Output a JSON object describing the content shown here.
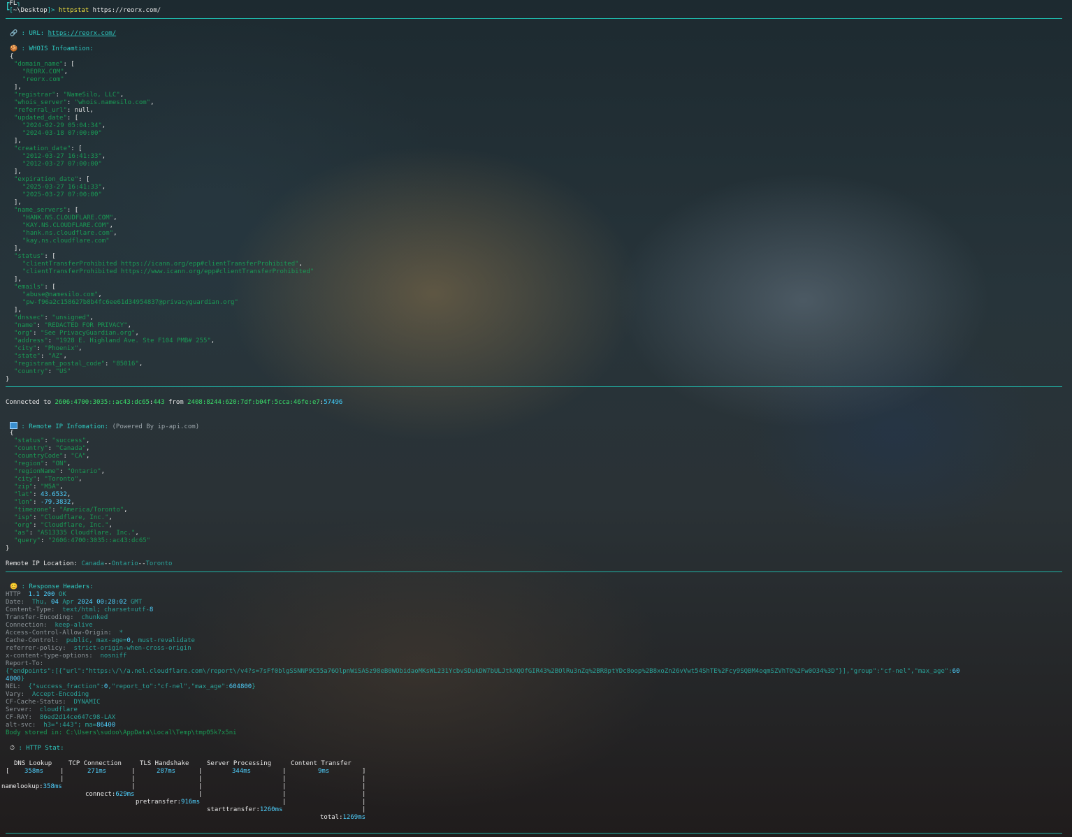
{
  "prompt": {
    "tag": "FL",
    "path": "~\\Desktop",
    "command": "httpstat",
    "arg": "https://reorx.com/"
  },
  "url_section": {
    "label": "URL:",
    "url": "https://reorx.com/"
  },
  "whois": {
    "title": "WHOIS Infoamtion:",
    "domain_name": [
      "REORX.COM",
      "reorx.com"
    ],
    "registrar": "NameSilo, LLC",
    "whois_server": "whois.namesilo.com",
    "referral_url": "null",
    "updated_date": [
      "2024-02-29 05:04:34",
      "2024-03-18 07:00:00"
    ],
    "creation_date": [
      "2012-03-27 16:41:33",
      "2012-03-27 07:00:00"
    ],
    "expiration_date": [
      "2025-03-27 16:41:33",
      "2025-03-27 07:00:00"
    ],
    "name_servers": [
      "HANK.NS.CLOUDFLARE.COM",
      "KAY.NS.CLOUDFLARE.COM",
      "hank.ns.cloudflare.com",
      "kay.ns.cloudflare.com"
    ],
    "status": [
      "clientTransferProhibited https://icann.org/epp#clientTransferProhibited",
      "clientTransferProhibited https://www.icann.org/epp#clientTransferProhibited"
    ],
    "emails": [
      "abuse@namesilo.com",
      "pw-f96a2c158627b8b4fc6ee61d34954837@privacyguardian.org"
    ],
    "dnssec": "unsigned",
    "name": "REDACTED FOR PRIVACY",
    "org": "See PrivacyGuardian.org",
    "address": "1928 E. Highland Ave. Ste F104 PMB# 255",
    "city": "Phoenix",
    "state": "AZ",
    "registrant_postal_code": "85016",
    "country": "US"
  },
  "connection": {
    "prefix": "Connected to",
    "remote_addr": "2606:4700:3035::ac43:dc65",
    "remote_port": "443",
    "from_word": "from",
    "local_addr": "2408:8244:620:7df:b04f:5cca:46fe:e7",
    "local_port": "57496"
  },
  "remote_ip": {
    "title": "Remote IP Infomation:",
    "powered": "(Powered By ip-api.com)",
    "fields": [
      {
        "k": "status",
        "v": "success",
        "t": "s"
      },
      {
        "k": "country",
        "v": "Canada",
        "t": "s"
      },
      {
        "k": "countryCode",
        "v": "CA",
        "t": "s"
      },
      {
        "k": "region",
        "v": "ON",
        "t": "s"
      },
      {
        "k": "regionName",
        "v": "Ontario",
        "t": "s"
      },
      {
        "k": "city",
        "v": "Toronto",
        "t": "s"
      },
      {
        "k": "zip",
        "v": "M5A",
        "t": "s"
      },
      {
        "k": "lat",
        "v": "43.6532",
        "t": "n"
      },
      {
        "k": "lon",
        "v": "-79.3832",
        "t": "n"
      },
      {
        "k": "timezone",
        "v": "America/Toronto",
        "t": "s"
      },
      {
        "k": "isp",
        "v": "Cloudflare, Inc.",
        "t": "s"
      },
      {
        "k": "org",
        "v": "Cloudflare, Inc.",
        "t": "s"
      },
      {
        "k": "as",
        "v": "AS13335 Cloudflare, Inc.",
        "t": "s"
      },
      {
        "k": "query",
        "v": "2606:4700:3035::ac43:dc65",
        "t": "s"
      }
    ],
    "location_label": "Remote IP Location:",
    "location": [
      "Canada",
      "Ontario",
      "Toronto"
    ]
  },
  "headers": {
    "title": "Response Headers:",
    "status_line": {
      "proto": "HTTP",
      "version": "1.1",
      "code": "200",
      "reason": "OK"
    },
    "date": {
      "k": "Date:",
      "dow": "Thu,",
      "day": "04",
      "mon": "Apr",
      "year": "2024",
      "time": "00:28:02",
      "tz": "GMT"
    },
    "content_type": {
      "k": "Content-Type:",
      "v": "text/html; charset=utf-",
      "n": "8"
    },
    "transfer_encoding": {
      "k": "Transfer-Encoding:",
      "v": "chunked"
    },
    "connection": {
      "k": "Connection:",
      "v": "keep-alive"
    },
    "acao": {
      "k": "Access-Control-Allow-Origin:",
      "v": "*"
    },
    "cache_control": {
      "k": "Cache-Control:",
      "v1": "public, max-age=",
      "n": "0",
      "v2": ", must-revalidate"
    },
    "referrer_policy": {
      "k": "referrer-policy:",
      "v": "strict-origin-when-cross-origin"
    },
    "xcto": {
      "k": "x-content-type-options:",
      "v": "nosniff"
    },
    "report_to_key": "Report-To:",
    "report_to_line1_a": "{\"endpoints\":[{\"url\":\"",
    "report_to_url": "https:\\/\\/a.nel.cloudflare.com\\/report\\/v4?s=7sFf0blgSSNNP9C55a76OlpnWiSASz98eB0WObidaoMKsWL231YcbvSDukDW7bULJtkXQOfGIR43%2BOlRu3nZq%2BR8ptYDc8oop%2B8xoZn26vVwt54ShTE%2Fcy9SQBM4oqmSZVhTQ%2Fw0O34%3D",
    "report_to_line1_b": "\"}],\"group\":\"cf-nel\",\"max_age\":",
    "report_to_num1": "60",
    "report_to_num2": "4800",
    "report_to_line2_end": "}",
    "nel": {
      "k": "NEL:",
      "a": "{\"success_fraction\":",
      "n1": "0",
      "b": ",\"report_to\":\"cf-nel\",\"max_age\":",
      "n2": "604800",
      "c": "}"
    },
    "vary": {
      "k": "Vary:",
      "v": "Accept-Encoding"
    },
    "cf_cache": {
      "k": "CF-Cache-Status:",
      "v": "DYNAMIC"
    },
    "server": {
      "k": "Server:",
      "v": "cloudflare"
    },
    "cf_ray": {
      "k": "CF-RAY:",
      "v": "86ed2d14ce647c98-LAX"
    },
    "alt_svc": {
      "k": "alt-svc:",
      "v": "h3=\":443\"; ma=",
      "n": "86400"
    },
    "body_stored": "Body stored in: C:\\Users\\sudoo\\AppData\\Local\\Temp\\tmp05k7x5ni"
  },
  "stat": {
    "title": "HTTP Stat:",
    "phases": [
      "DNS Lookup",
      "TCP Connection",
      "TLS Handshake",
      "Server Processing",
      "Content Transfer"
    ],
    "values": [
      "358ms",
      "271ms",
      "287ms",
      "344ms",
      "9ms"
    ],
    "namelookup": "358ms",
    "connect": "629ms",
    "pretransfer": "916ms",
    "starttransfer": "1260ms",
    "total": "1269ms",
    "labels": {
      "namelookup": "namelookup:",
      "connect": "connect:",
      "pretransfer": "pretransfer:",
      "starttransfer": "starttransfer:",
      "total": "total:"
    }
  }
}
